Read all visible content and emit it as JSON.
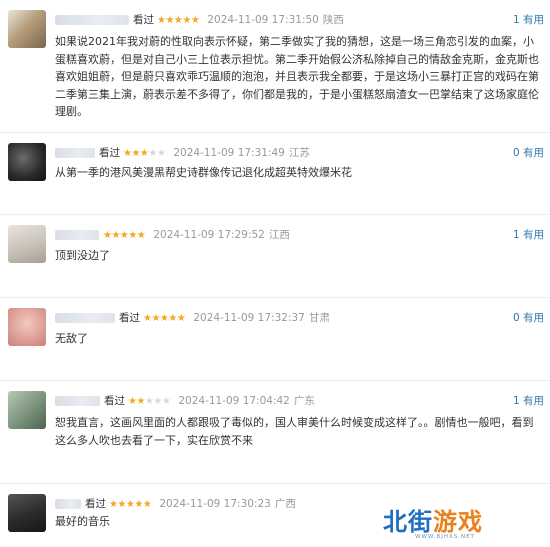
{
  "reviews": [
    {
      "avatar_color": "#b79d7c",
      "status": "看过",
      "rating": 5,
      "time": "2024-11-09 17:31:50",
      "location": "陕西",
      "useful": "1 有用",
      "content": "如果说2021年我对蔚的性取向表示怀疑，第二季做实了我的猜想，这是一场三角恋引发的血案，小蛋糕喜欢蔚，但是对自己小三上位表示担忧。第二季开始假公济私除掉自己的情敌金克斯，金克斯也喜欢姐姐蔚，但是蔚只喜欢乖巧温顺的泡泡，并且表示我全都要，于是这场小三暴打正宫的戏码在第二季第三集上演，蔚表示差不多得了，你们都是我的，于是小蛋糕怒扇渣女一巴掌结束了这场家庭伦理剧。"
    },
    {
      "avatar_color": "#3a3a3a",
      "status": "看过",
      "rating": 3,
      "time": "2024-11-09 17:31:49",
      "location": "江苏",
      "useful": "0 有用",
      "content": "从第一季的港风美漫黑帮史诗群像传记退化成超英特效爆米花"
    },
    {
      "avatar_color": "#c9c2b8",
      "status": "",
      "rating": 5,
      "time": "2024-11-09 17:29:52",
      "location": "江西",
      "useful": "1 有用",
      "content": "顶到没边了"
    },
    {
      "avatar_color": "#e0a49c",
      "status": "看过",
      "rating": 5,
      "time": "2024-11-09 17:32:37",
      "location": "甘肃",
      "useful": "0 有用",
      "content": "无敌了"
    },
    {
      "avatar_color": "#7f9680",
      "status": "看过",
      "rating": 2,
      "time": "2024-11-09 17:04:42",
      "location": "广东",
      "useful": "1 有用",
      "content": "恕我直言，这画风里面的人都跟吸了毒似的，国人审美什么时候变成这样了。。剧情也一般吧，看到这么多人吹也去看了一下，实在欣赏不来"
    },
    {
      "avatar_color": "#2e2e2e",
      "status": "看过",
      "rating": 5,
      "time": "2024-11-09 17:30:23",
      "location": "广西",
      "useful": "",
      "content": "最好的音乐"
    }
  ],
  "watermark": {
    "part1": "北街",
    "part2": "游戏",
    "url": "WWW.BJHXS.NET"
  }
}
